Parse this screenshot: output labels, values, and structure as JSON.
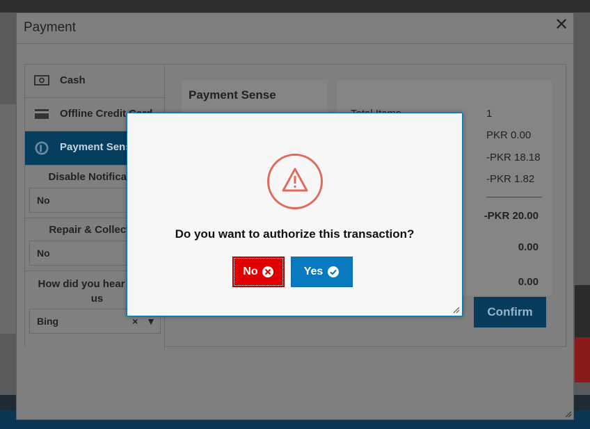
{
  "payment_dialog": {
    "title": "Payment",
    "methods": [
      {
        "label": "Cash",
        "icon": "cash-icon"
      },
      {
        "label": "Offline Credit Card",
        "icon": "credit-card-icon"
      },
      {
        "label": "Payment Sense",
        "icon": "payment-sense-icon",
        "active": true
      }
    ],
    "fields": [
      {
        "label": "Disable Notification",
        "value": "No"
      },
      {
        "label": "Repair & Collection",
        "value": "No"
      },
      {
        "label_line1": "How did you hear about",
        "label_line2": "us",
        "value": "Bing",
        "clear": "×",
        "arrow": "▼"
      }
    ],
    "panel_title": "Payment Sense",
    "summary": [
      {
        "label": "Total Items",
        "value": "1"
      },
      {
        "label": "",
        "value": "PKR 0.00"
      },
      {
        "label": "",
        "value": "-PKR 18.18"
      },
      {
        "label": "",
        "value": "-PKR 1.82"
      },
      {
        "label": "",
        "value": "-PKR 20.00"
      },
      {
        "label": "",
        "value": "0.00"
      },
      {
        "label": "",
        "value": "0.00"
      }
    ],
    "confirm_label": "Confirm"
  },
  "modal": {
    "question": "Do you want to authorize this transaction?",
    "no_label": "No",
    "yes_label": "Yes",
    "icon": "warning-icon"
  },
  "colors": {
    "no_button": "#e00000",
    "yes_button": "#0a7ac0",
    "warning": "#e06b5c"
  }
}
